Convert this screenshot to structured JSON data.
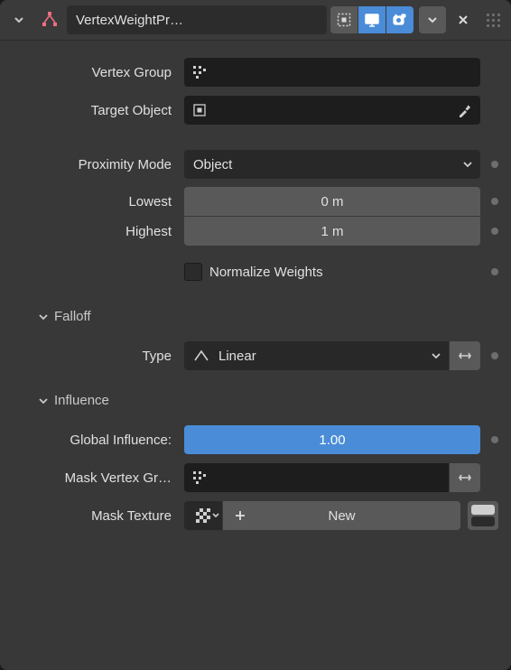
{
  "header": {
    "title": "VertexWeightPr…"
  },
  "fields": {
    "vertex_group_label": "Vertex Group",
    "vertex_group_value": "",
    "target_object_label": "Target Object",
    "target_object_value": "",
    "proximity_mode_label": "Proximity Mode",
    "proximity_mode_value": "Object",
    "lowest_label": "Lowest",
    "lowest_value": "0 m",
    "highest_label": "Highest",
    "highest_value": "1 m",
    "normalize_label": "Normalize Weights"
  },
  "falloff": {
    "section_label": "Falloff",
    "type_label": "Type",
    "type_value": "Linear"
  },
  "influence": {
    "section_label": "Influence",
    "global_label": "Global Influence:",
    "global_value": "1.00",
    "mask_vg_label": "Mask Vertex Gr…",
    "mask_vg_value": "",
    "mask_tex_label": "Mask Texture",
    "new_label": "New"
  }
}
